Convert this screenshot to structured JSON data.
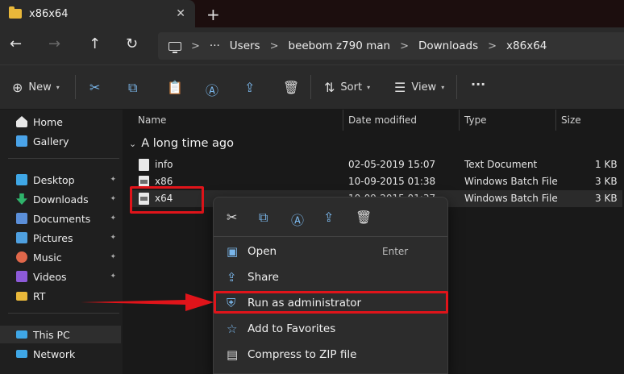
{
  "window": {
    "tab_title": "x86x64",
    "close_glyph": "✕",
    "new_tab_glyph": "+"
  },
  "nav": {
    "back_glyph": "←",
    "forward_glyph": "→",
    "up_glyph": "↑",
    "refresh_glyph": "↻"
  },
  "breadcrumb": {
    "more": "···",
    "items": [
      "Users",
      "beebom z790 man",
      "Downloads",
      "x86x64"
    ],
    "sep": ">"
  },
  "toolbar": {
    "new_label": "New",
    "sort_label": "Sort",
    "view_label": "View",
    "more_glyph": "···",
    "chevron": "▾"
  },
  "sidebar": {
    "items": [
      {
        "label": "Home",
        "icon": "home-icon",
        "pinned": false
      },
      {
        "label": "Gallery",
        "icon": "gallery-icon",
        "pinned": false
      },
      {
        "label": "Desktop",
        "icon": "desktop-icon",
        "pinned": true
      },
      {
        "label": "Downloads",
        "icon": "downloads-icon",
        "pinned": true
      },
      {
        "label": "Documents",
        "icon": "documents-icon",
        "pinned": true
      },
      {
        "label": "Pictures",
        "icon": "pictures-icon",
        "pinned": true
      },
      {
        "label": "Music",
        "icon": "music-icon",
        "pinned": true
      },
      {
        "label": "Videos",
        "icon": "videos-icon",
        "pinned": true
      },
      {
        "label": "RT",
        "icon": "folder-icon",
        "pinned": false
      },
      {
        "label": "This PC",
        "icon": "pc-icon",
        "pinned": false
      },
      {
        "label": "Network",
        "icon": "network-icon",
        "pinned": false
      }
    ],
    "pin_glyph": "📌"
  },
  "columns": {
    "name": "Name",
    "date": "Date modified",
    "type": "Type",
    "size": "Size"
  },
  "group": {
    "label": "A long time ago",
    "chevron": "⌄"
  },
  "files": [
    {
      "name": "info",
      "date": "02-05-2019 15:07",
      "type": "Text Document",
      "size": "1 KB"
    },
    {
      "name": "x86",
      "date": "10-09-2015 01:38",
      "type": "Windows Batch File",
      "size": "3 KB"
    },
    {
      "name": "x64",
      "date": "10-09-2015 01:37",
      "type": "Windows Batch File",
      "size": "3 KB"
    }
  ],
  "context_menu": {
    "items": [
      {
        "label": "Open",
        "shortcut": "Enter",
        "icon": "open-icon"
      },
      {
        "label": "Share",
        "shortcut": "",
        "icon": "share-icon"
      },
      {
        "label": "Run as administrator",
        "shortcut": "",
        "icon": "shield-icon"
      },
      {
        "label": "Add to Favorites",
        "shortcut": "",
        "icon": "star-icon"
      },
      {
        "label": "Compress to ZIP file",
        "shortcut": "",
        "icon": "zip-icon"
      }
    ]
  },
  "colors": {
    "highlight": "#e0141a",
    "accent": "#7ab6ea",
    "folder": "#e9b83a"
  }
}
